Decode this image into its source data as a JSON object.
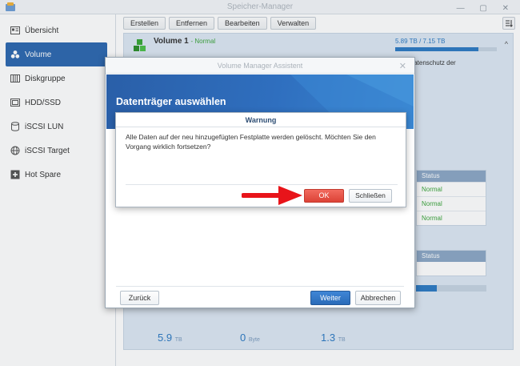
{
  "window": {
    "title": "Speicher-Manager"
  },
  "sidebar": {
    "items": [
      {
        "label": "Übersicht",
        "icon": "overview-icon",
        "active": false
      },
      {
        "label": "Volume",
        "icon": "volume-icon",
        "active": true
      },
      {
        "label": "Diskgruppe",
        "icon": "disk-group-icon",
        "active": false
      },
      {
        "label": "HDD/SSD",
        "icon": "hdd-icon",
        "active": false
      },
      {
        "label": "iSCSI LUN",
        "icon": "iscsi-lun-icon",
        "active": false
      },
      {
        "label": "iSCSI Target",
        "icon": "iscsi-target-icon",
        "active": false
      },
      {
        "label": "Hot Spare",
        "icon": "hot-spare-icon",
        "active": false
      }
    ]
  },
  "toolbar": {
    "create": "Erstellen",
    "remove": "Entfernen",
    "edit": "Bearbeiten",
    "manage": "Verwalten"
  },
  "volume": {
    "name": "Volume 1",
    "status": "- Normal",
    "usage_text": "5.89 TB / 7.15 TB",
    "usage_fraction": 0.82,
    "desc_fragment": "t Datenschutz der",
    "table1_header": "Status",
    "table1_rows": [
      "Normal",
      "Normal",
      "Normal"
    ],
    "table2_header": "Status",
    "small_bar_fraction": 0.3,
    "stats": [
      {
        "value": "5.9",
        "unit": "TB"
      },
      {
        "value": "0",
        "unit": "Byte"
      },
      {
        "value": "1.3",
        "unit": "TB"
      }
    ]
  },
  "wizard": {
    "title": "Volume Manager Assistent",
    "heading": "Datenträger auswählen",
    "back": "Zurück",
    "next": "Weiter",
    "cancel": "Abbrechen"
  },
  "warning": {
    "title": "Warnung",
    "message": "Alle Daten auf der neu hinzugefügten Festplatte werden gelöscht. Möchten Sie den Vorgang wirklich fortsetzen?",
    "ok": "OK",
    "close": "Schließen"
  },
  "colors": {
    "accent": "#2e69b0",
    "ok_button": "#e0483c",
    "status_ok": "#3da53d",
    "arrow": "#e8141a"
  }
}
